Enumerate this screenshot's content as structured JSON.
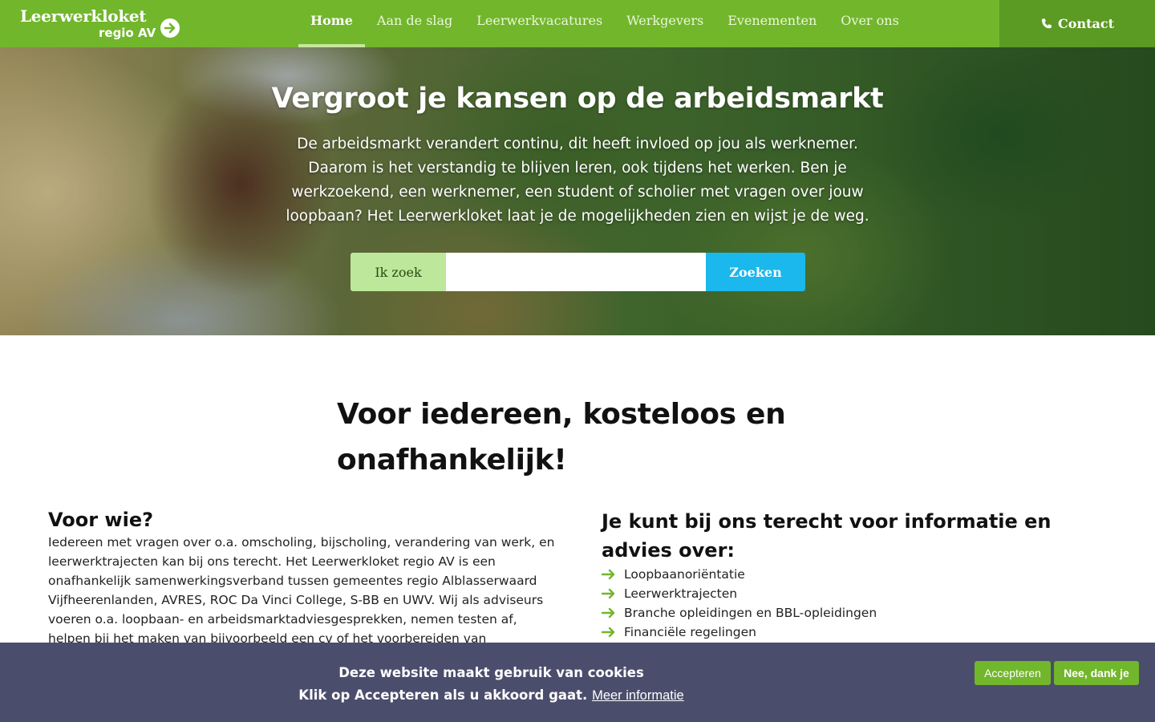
{
  "header": {
    "logo_title": "Leerwerkloket",
    "logo_subtitle": "regio AV",
    "nav": [
      {
        "label": "Home",
        "active": true
      },
      {
        "label": "Aan de slag"
      },
      {
        "label": "Leerwerkvacatures"
      },
      {
        "label": "Werkgevers"
      },
      {
        "label": "Evenementen"
      },
      {
        "label": "Over ons"
      }
    ],
    "contact_label": "Contact"
  },
  "hero": {
    "title": "Vergroot je kansen op de arbeidsmarkt",
    "text": "De arbeidsmarkt verandert continu, dit heeft invloed op jou als werknemer. Daarom is het verstandig te blijven leren, ook tijdens het werken. Ben je werkzoekend, een werknemer, een student of scholier met vragen over jouw loopbaan? Het Leerwerkloket laat je de mogelijkheden zien en wijst je de weg.",
    "search": {
      "label": "Ik zoek",
      "value": "",
      "placeholder": "",
      "button": "Zoeken"
    }
  },
  "main": {
    "title": "Voor iedereen, kosteloos en onafhankelijk!",
    "left": {
      "heading": "Voor wie?",
      "text": "Iedereen met vragen over o.a. omscholing, bijscholing, verandering van werk, en leerwerktrajecten kan bij ons terecht. Het Leerwerkloket regio AV is een onafhankelijk samenwerkingsverband tussen gemeentes regio Alblasserwaard Vijfheerenlanden, AVRES, ROC Da Vinci College, S-BB en UWV. Wij als adviseurs voeren o.a. loopbaan- en arbeidsmarktadviesgesprekken, nemen testen af, helpen bij het maken van bijvoorbeeld een cv of het voorbereiden van"
    },
    "right": {
      "heading": "Je kunt bij ons terecht voor informatie en advies over:",
      "items": [
        "Loopbaanoriëntatie",
        "Leerwerktrajecten",
        "Branche opleidingen en BBL-opleidingen",
        "Financiële regelingen"
      ]
    }
  },
  "cookie": {
    "line1": "Deze website maakt gebruik van cookies",
    "line2": "Klik op Accepteren als u akkoord gaat.",
    "link": "Meer informatie",
    "accept": "Accepteren",
    "decline": "Nee, dank je"
  },
  "colors": {
    "brand_green": "#72b62c",
    "contact_green": "#5b9a23",
    "search_blue": "#1ab8ec",
    "cookie_bg": "#4b4d6c"
  },
  "icons": {
    "logo_arrow": "arrow-right-circle-icon",
    "contact": "phone-icon",
    "list_bullet": "arrow-right-icon"
  }
}
